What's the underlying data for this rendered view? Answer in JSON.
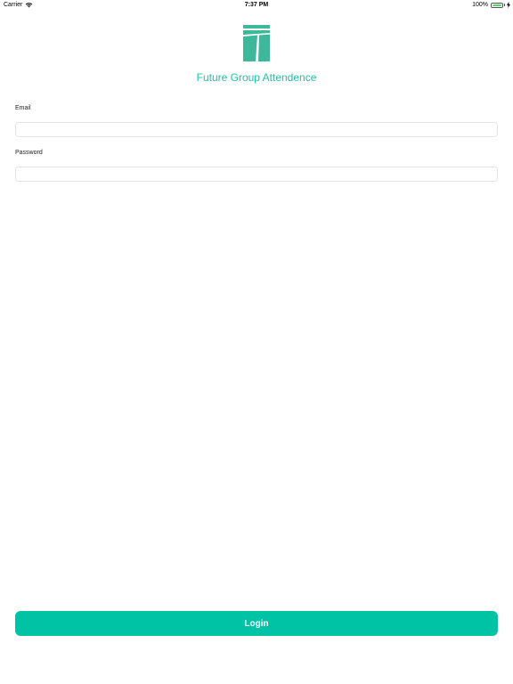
{
  "status_bar": {
    "carrier": "Carrier",
    "time": "7:37 PM",
    "battery": "100%",
    "wifi_icon": "wifi-icon",
    "battery_icon": "battery-icon",
    "charging_icon": "charging-bolt-icon"
  },
  "header": {
    "logo_icon": "future-group-logo",
    "title": "Future Group Attendence"
  },
  "form": {
    "email_label": "Email",
    "email_value": "",
    "email_placeholder": "",
    "password_label": "Password",
    "password_value": "",
    "password_placeholder": "",
    "login_label": "Login"
  },
  "colors": {
    "accent": "#00c3a5",
    "title": "#1cc3a3",
    "logo": "#3db89a"
  }
}
